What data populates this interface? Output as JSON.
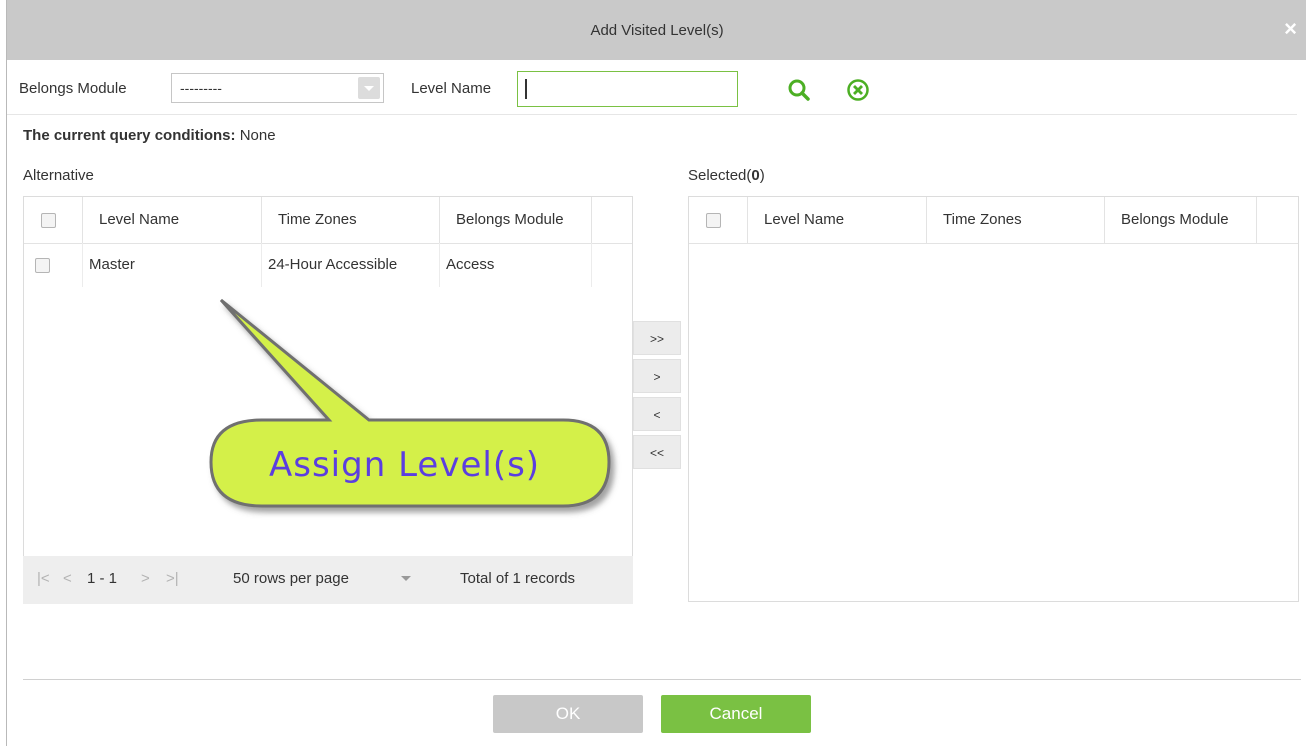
{
  "dialog": {
    "title": "Add Visited Level(s)",
    "close_label": "×"
  },
  "query": {
    "belongs_module_label": "Belongs Module",
    "belongs_module_value": "---------",
    "level_name_label": "Level Name",
    "level_name_value": "",
    "search_icon": "search-icon",
    "clear_icon": "clear-icon"
  },
  "conditions": {
    "label": "The current query conditions:",
    "value": "None"
  },
  "alternative": {
    "title": "Alternative",
    "columns": [
      "Level Name",
      "Time Zones",
      "Belongs Module"
    ],
    "rows": [
      {
        "level_name": "Master",
        "time_zone": "24-Hour Accessible",
        "module": "Access"
      }
    ],
    "pager": {
      "first": "|<",
      "prev": "<",
      "range": "1 - 1",
      "next": ">",
      "last": ">|",
      "rows_per_page": "50 rows per page",
      "total": "Total of 1 records"
    }
  },
  "selected": {
    "title_prefix": "Selected(",
    "count": "0",
    "title_suffix": ")",
    "columns": [
      "Level Name",
      "Time Zones",
      "Belongs Module"
    ]
  },
  "move_buttons": {
    "add_all": ">>",
    "add": ">",
    "remove": "<",
    "remove_all": "<<"
  },
  "callout": {
    "text": "Assign Level(s)"
  },
  "footer": {
    "ok_label": "OK",
    "cancel_label": "Cancel"
  },
  "colors": {
    "accent": "#7ac143",
    "titlebar": "#c9c9c9",
    "callout_fill": "#d4f04a",
    "callout_text": "#5b3ee0"
  }
}
